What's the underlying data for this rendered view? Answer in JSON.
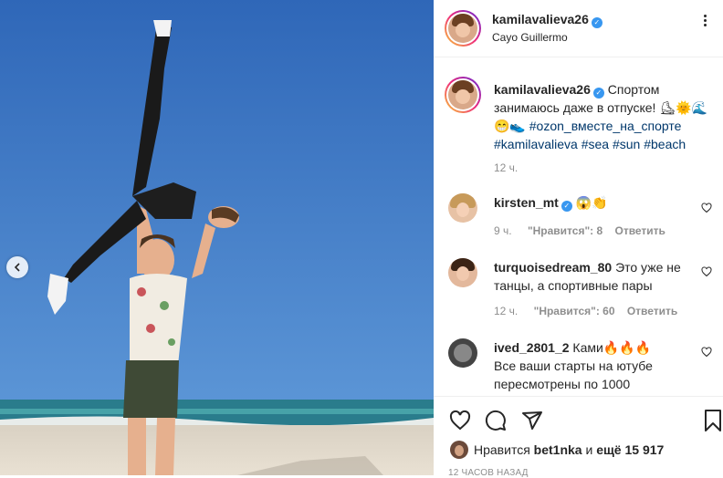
{
  "post": {
    "username": "kamilavalieva26",
    "location": "Cayo Guillermo",
    "caption_text": "Спортом занимаюсь даже в отпуске!",
    "caption_emojis": "⛸🌞🌊😁👟",
    "hashtags": [
      "#ozon_вместе_на_спорте",
      "#kamilavalieva",
      "#sea",
      "#sun",
      "#beach"
    ],
    "time": "12 ч."
  },
  "comments": [
    {
      "username": "kirsten_mt",
      "verified": true,
      "text": "😱👏",
      "time": "9 ч.",
      "likes": "\"Нравится\": 8",
      "reply": "Ответить"
    },
    {
      "username": "turquoisedream_80",
      "text": "Это уже не танцы, а спортивные пары",
      "time": "12 ч.",
      "likes": "\"Нравится\": 60",
      "reply": "Ответить"
    },
    {
      "username": "ived_2801_2",
      "text": "Ками🔥🔥🔥Все ваши старты на ютубе пересмотрены по 1000"
    }
  ],
  "footer": {
    "likes_prefix": "Нравится",
    "liked_by": "bet1nka",
    "likes_middle": "и",
    "likes_more": "ещё 15 917",
    "timestamp": "12 ЧАСОВ НАЗАД"
  },
  "colors": {
    "accent": "#3897f0",
    "hashtag": "#00376b",
    "muted": "#8e8e8e"
  },
  "icons": [
    "verified-badge-icon",
    "more-options-icon",
    "heart-icon",
    "comment-icon",
    "share-icon",
    "bookmark-icon",
    "carousel-prev-icon"
  ]
}
